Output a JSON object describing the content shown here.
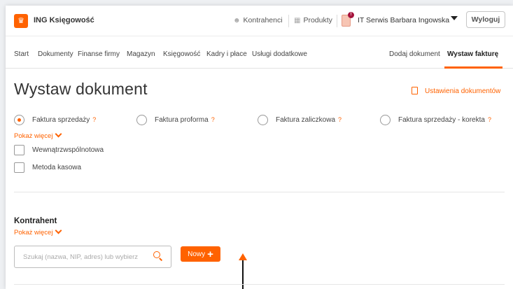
{
  "header": {
    "brand": "ING Księgowość",
    "links": [
      {
        "label": "Kontrahenci",
        "icon": "users-icon"
      },
      {
        "label": "Produkty",
        "icon": "grid-icon"
      }
    ],
    "company_badge": "!",
    "company": "IT Serwis Barbara Ingowska",
    "logout": "Wyloguj"
  },
  "nav": {
    "items": [
      "Start",
      "Dokumenty",
      "Finanse firmy",
      "Magazyn",
      "Księgowość",
      "Kadry i płace",
      "Usługi dodatkowe"
    ],
    "right": [
      "Dodaj dokument",
      "Wystaw fakturę"
    ],
    "active": "Wystaw fakturę"
  },
  "main": {
    "title": "Wystaw dokument",
    "settings_link": "Ustawienia dokumentów",
    "doc_types": [
      {
        "label": "Faktura sprzedaży",
        "selected": true
      },
      {
        "label": "Faktura proforma",
        "selected": false
      },
      {
        "label": "Faktura zaliczkowa",
        "selected": false
      },
      {
        "label": "Faktura sprzedaży - korekta",
        "selected": false
      }
    ],
    "help_glyph": "?",
    "show_more": "Pokaż więcej",
    "options": [
      {
        "label": "Wewnątrzwspólnotowa",
        "checked": false
      },
      {
        "label": "Metoda kasowa",
        "checked": false
      }
    ]
  },
  "contractor": {
    "title": "Kontrahent",
    "show_more": "Pokaż więcej",
    "search_placeholder": "Szukaj (nazwa, NIP, adres) lub wybierz",
    "new_button": "Nowy",
    "new_button_icon": "+"
  },
  "colors": {
    "accent": "#ff6200",
    "text": "#333333",
    "border": "#bdbdbd"
  }
}
